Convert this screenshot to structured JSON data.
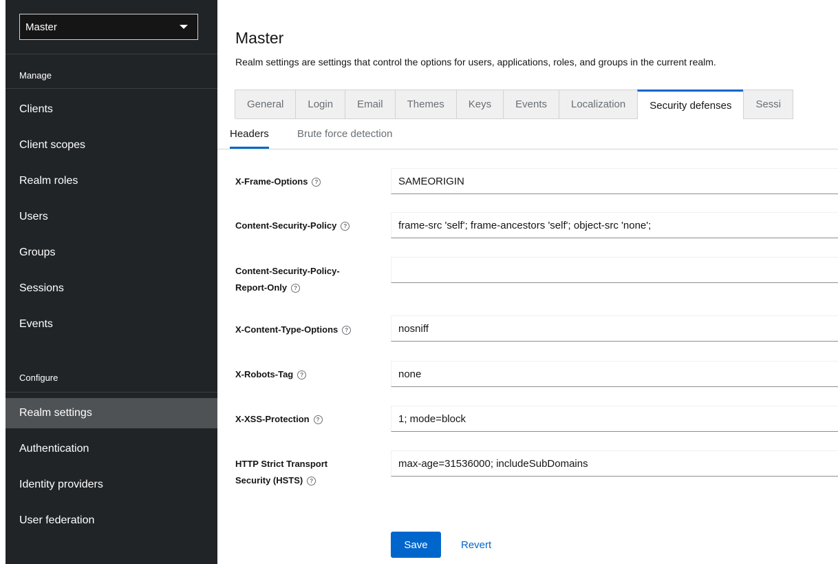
{
  "sidebar": {
    "realm_selector": {
      "value": "Master"
    },
    "sections": [
      {
        "title": "Manage"
      },
      {
        "title": "Configure"
      }
    ],
    "manage_items": [
      {
        "label": "Clients"
      },
      {
        "label": "Client scopes"
      },
      {
        "label": "Realm roles"
      },
      {
        "label": "Users"
      },
      {
        "label": "Groups"
      },
      {
        "label": "Sessions"
      },
      {
        "label": "Events"
      }
    ],
    "configure_items": [
      {
        "label": "Realm settings",
        "active": true
      },
      {
        "label": "Authentication"
      },
      {
        "label": "Identity providers"
      },
      {
        "label": "User federation"
      }
    ]
  },
  "header": {
    "title": "Master",
    "description": "Realm settings are settings that control the options for users, applications, roles, and groups in the current realm."
  },
  "tabs": [
    {
      "label": "General"
    },
    {
      "label": "Login"
    },
    {
      "label": "Email"
    },
    {
      "label": "Themes"
    },
    {
      "label": "Keys"
    },
    {
      "label": "Events"
    },
    {
      "label": "Localization"
    },
    {
      "label": "Security defenses",
      "active": true
    },
    {
      "label": "Sessi"
    }
  ],
  "subtabs": [
    {
      "label": "Headers",
      "active": true
    },
    {
      "label": "Brute force detection"
    }
  ],
  "form": {
    "fields": [
      {
        "label": "X-Frame-Options",
        "value": "SAMEORIGIN"
      },
      {
        "label": "Content-Security-Policy",
        "value": "frame-src 'self'; frame-ancestors 'self'; object-src 'none';"
      },
      {
        "label_line1": "Content-Security-Policy-",
        "label_line2": "Report-Only",
        "value": ""
      },
      {
        "label": "X-Content-Type-Options",
        "value": "nosniff"
      },
      {
        "label": "X-Robots-Tag",
        "value": "none"
      },
      {
        "label": "X-XSS-Protection",
        "value": "1; mode=block"
      },
      {
        "label_line1": "HTTP Strict Transport",
        "label_line2": "Security (HSTS)",
        "value": "max-age=31536000; includeSubDomains"
      }
    ],
    "help_icon": "help-circle-icon",
    "save_label": "Save",
    "revert_label": "Revert"
  },
  "colors": {
    "sidebar_bg": "#212427",
    "sidebar_active_bg": "#4f5255",
    "primary": "#0066cc"
  }
}
